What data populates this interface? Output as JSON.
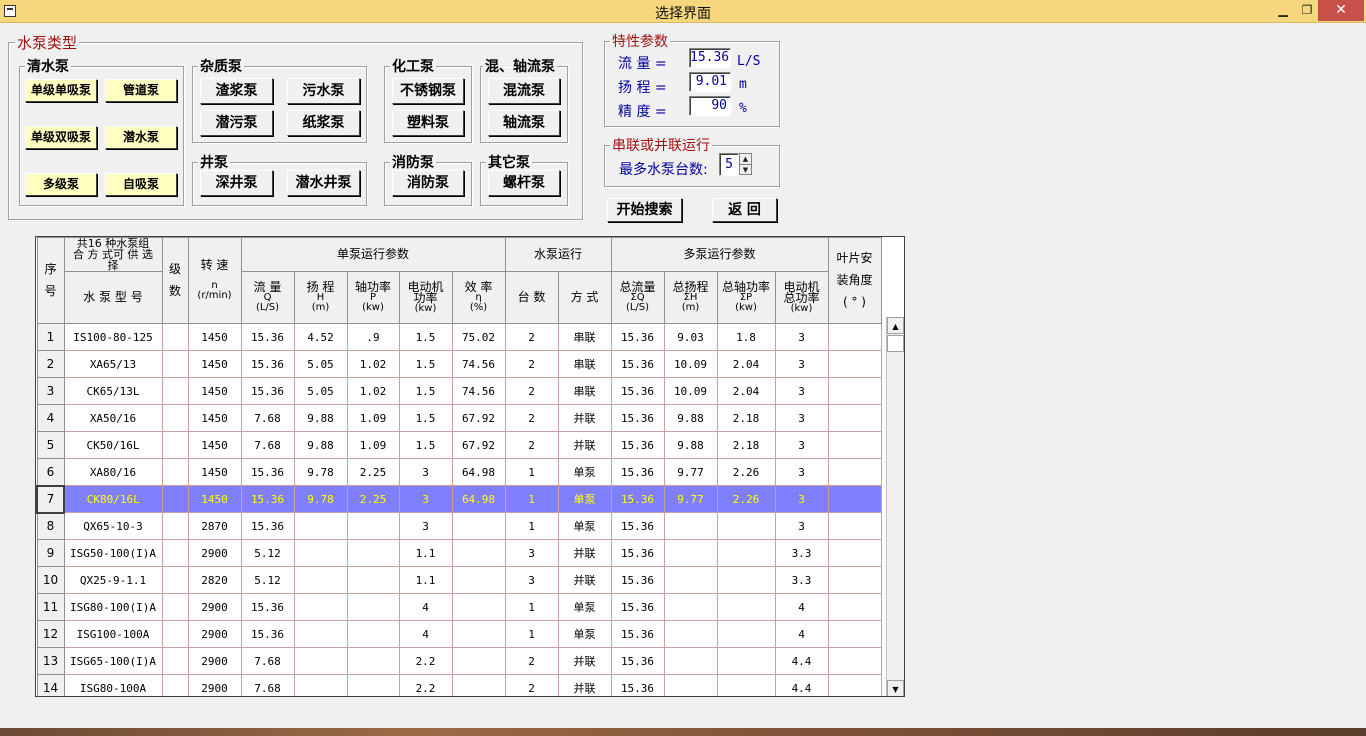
{
  "window": {
    "title": "选择界面",
    "minimize": "▁",
    "maximize": "❐",
    "close": "✕"
  },
  "pump_types": {
    "legend": "水泵类型",
    "clear_water": {
      "legend": "清水泵",
      "buttons": [
        "单级单吸泵",
        "管道泵",
        "单级双吸泵",
        "潜水泵",
        "多级泵",
        "自吸泵"
      ]
    },
    "impurity": {
      "legend": "杂质泵",
      "buttons": [
        "渣浆泵",
        "污水泵",
        "潜污泵",
        "纸浆泵"
      ]
    },
    "chemical": {
      "legend": "化工泵",
      "buttons": [
        "不锈钢泵",
        "塑料泵"
      ]
    },
    "mixed_axial": {
      "legend": "混、轴流泵",
      "buttons": [
        "混流泵",
        "轴流泵"
      ]
    },
    "well": {
      "legend": "井泵",
      "buttons": [
        "深井泵",
        "潜水井泵"
      ]
    },
    "fire": {
      "legend": "消防泵",
      "buttons": [
        "消防泵"
      ]
    },
    "other": {
      "legend": "其它泵",
      "buttons": [
        "螺杆泵"
      ]
    }
  },
  "characteristics": {
    "legend": "特性参数",
    "flow": {
      "label": "流  量 =",
      "value": "15.36",
      "unit": "L/S"
    },
    "head": {
      "label": "扬  程 =",
      "value": "9.01",
      "unit": "m"
    },
    "precision": {
      "label": "精  度 =",
      "value": "90",
      "unit": "%"
    }
  },
  "series_parallel": {
    "legend": "串联或并联运行",
    "label": "最多水泵台数:",
    "value": "5"
  },
  "actions": {
    "search": "开始搜索",
    "back": "返  回"
  },
  "grid": {
    "headers": {
      "index_top": "序",
      "index_bottom": "号",
      "combo_top": "共16 种水泵组 合 方 式可 供 选 择",
      "model": "水 泵 型 号",
      "stage_top": "级",
      "stage_bottom": "数",
      "speed_top": "转  速",
      "speed_n": "n",
      "speed_unit": "(r/min)",
      "single_group": "单泵运行参数",
      "flow": "流  量",
      "flow_sym": "Q",
      "flow_unit": "(L/S)",
      "head": "扬  程",
      "head_sym": "H",
      "head_unit": "(m)",
      "shaft": "轴功率",
      "shaft_sym": "P",
      "shaft_unit": "(kw)",
      "motor": "电动机",
      "motor2": "功率",
      "motor_unit": "(kw)",
      "eff": "效  率",
      "eff_sym": "η",
      "eff_unit": "(%)",
      "run_group": "水泵运行",
      "count": "台  数",
      "mode": "方  式",
      "multi_group": "多泵运行参数",
      "tflow": "总流量",
      "tflow_sym": "ΣQ",
      "tflow_unit": "(L/S)",
      "thead": "总扬程",
      "thead_sym": "ΣH",
      "thead_unit": "(m)",
      "tshaft": "总轴功率",
      "tshaft_sym": "ΣP",
      "tshaft_unit": "(kw)",
      "tmotor": "电动机",
      "tmotor2": "总功率",
      "tmotor_unit": "(kw)",
      "blade1": "叶片安",
      "blade2": "装角度",
      "blade3": "( ° )"
    },
    "rows": [
      [
        "1",
        "IS100-80-125",
        "",
        "1450",
        "15.36",
        "4.52",
        ".9",
        "1.5",
        "75.02",
        "2",
        "串联",
        "15.36",
        "9.03",
        "1.8",
        "3",
        ""
      ],
      [
        "2",
        "XA65/13",
        "",
        "1450",
        "15.36",
        "5.05",
        "1.02",
        "1.5",
        "74.56",
        "2",
        "串联",
        "15.36",
        "10.09",
        "2.04",
        "3",
        ""
      ],
      [
        "3",
        "CK65/13L",
        "",
        "1450",
        "15.36",
        "5.05",
        "1.02",
        "1.5",
        "74.56",
        "2",
        "串联",
        "15.36",
        "10.09",
        "2.04",
        "3",
        ""
      ],
      [
        "4",
        "XA50/16",
        "",
        "1450",
        "7.68",
        "9.88",
        "1.09",
        "1.5",
        "67.92",
        "2",
        "并联",
        "15.36",
        "9.88",
        "2.18",
        "3",
        ""
      ],
      [
        "5",
        "CK50/16L",
        "",
        "1450",
        "7.68",
        "9.88",
        "1.09",
        "1.5",
        "67.92",
        "2",
        "并联",
        "15.36",
        "9.88",
        "2.18",
        "3",
        ""
      ],
      [
        "6",
        "XA80/16",
        "",
        "1450",
        "15.36",
        "9.78",
        "2.25",
        "3",
        "64.98",
        "1",
        "单泵",
        "15.36",
        "9.77",
        "2.26",
        "3",
        ""
      ],
      [
        "7",
        "CK80/16L",
        "",
        "1450",
        "15.36",
        "9.78",
        "2.25",
        "3",
        "64.98",
        "1",
        "单泵",
        "15.36",
        "9.77",
        "2.26",
        "3",
        ""
      ],
      [
        "8",
        "QX65-10-3",
        "",
        "2870",
        "15.36",
        "",
        "",
        "3",
        "",
        "1",
        "单泵",
        "15.36",
        "",
        "",
        "3",
        ""
      ],
      [
        "9",
        "ISG50-100(I)A",
        "",
        "2900",
        "5.12",
        "",
        "",
        "1.1",
        "",
        "3",
        "并联",
        "15.36",
        "",
        "",
        "3.3",
        ""
      ],
      [
        "10",
        "QX25-9-1.1",
        "",
        "2820",
        "5.12",
        "",
        "",
        "1.1",
        "",
        "3",
        "并联",
        "15.36",
        "",
        "",
        "3.3",
        ""
      ],
      [
        "11",
        "ISG80-100(I)A",
        "",
        "2900",
        "15.36",
        "",
        "",
        "4",
        "",
        "1",
        "单泵",
        "15.36",
        "",
        "",
        "4",
        ""
      ],
      [
        "12",
        "ISG100-100A",
        "",
        "2900",
        "15.36",
        "",
        "",
        "4",
        "",
        "1",
        "单泵",
        "15.36",
        "",
        "",
        "4",
        ""
      ],
      [
        "13",
        "ISG65-100(I)A",
        "",
        "2900",
        "7.68",
        "",
        "",
        "2.2",
        "",
        "2",
        "并联",
        "15.36",
        "",
        "",
        "4.4",
        ""
      ],
      [
        "14",
        "ISG80-100A",
        "",
        "2900",
        "7.68",
        "",
        "",
        "2.2",
        "",
        "2",
        "并联",
        "15.36",
        "",
        "",
        "4.4",
        ""
      ]
    ],
    "selected_row": 7
  }
}
